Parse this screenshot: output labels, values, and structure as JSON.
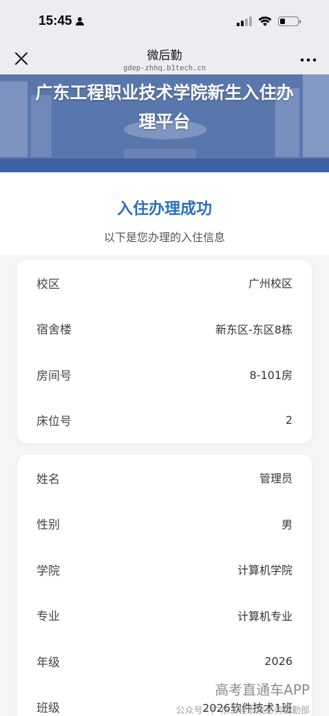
{
  "status_bar": {
    "time": "15:45"
  },
  "nav": {
    "title": "微后勤",
    "url": "gdep-zhhq.b1tech.cn",
    "close_icon": "close-icon",
    "more_icon": "more-icon"
  },
  "banner": {
    "title": "广东工程职业技术学院新生入住办理平台"
  },
  "header": {
    "title": "入住办理成功",
    "subtitle": "以下是您办理的入住信息"
  },
  "card_room": {
    "rows": [
      {
        "label": "校区",
        "value": "广州校区"
      },
      {
        "label": "宿舍楼",
        "value": "新东区-东区8栋"
      },
      {
        "label": "房间号",
        "value": "8-101房"
      },
      {
        "label": "床位号",
        "value": "2"
      }
    ]
  },
  "card_student": {
    "rows": [
      {
        "label": "姓名",
        "value": "管理员"
      },
      {
        "label": "性别",
        "value": "男"
      },
      {
        "label": "学院",
        "value": "计算机学院"
      },
      {
        "label": "专业",
        "value": "计算机专业"
      },
      {
        "label": "年级",
        "value": "2026"
      },
      {
        "label": "班级",
        "value": "2026软件技术1班"
      }
    ]
  },
  "watermark": {
    "main": "高考直通车APP",
    "sub": "公众号 · 广东工程职院总务后勤部"
  },
  "colors": {
    "accent": "#2e6fb8",
    "banner": "#4f6fa8"
  }
}
